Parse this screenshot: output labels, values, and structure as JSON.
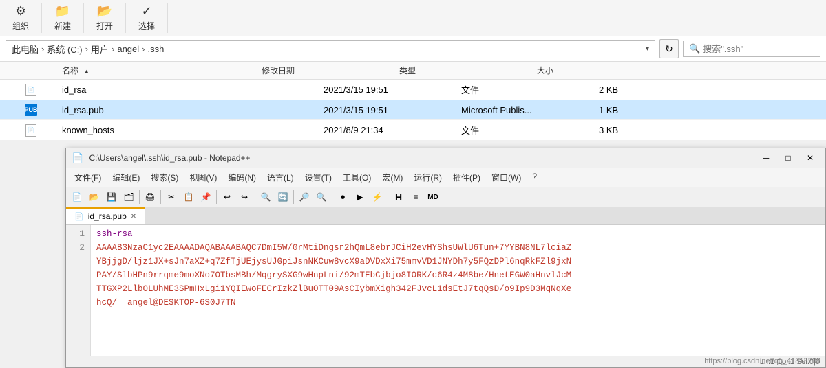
{
  "toolbar": {
    "organize_label": "组织",
    "new_label": "新建",
    "open_label": "打开",
    "select_label": "选择"
  },
  "address": {
    "path_parts": [
      "此电脑",
      "系统 (C:)",
      "用户",
      "angel",
      ".ssh"
    ],
    "search_placeholder": "搜索\".ssh\""
  },
  "file_list": {
    "headers": {
      "name": "名称",
      "date": "修改日期",
      "type": "类型",
      "size": "大小"
    },
    "files": [
      {
        "name": "id_rsa",
        "date": "2021/3/15 19:51",
        "type": "文件",
        "size": "2 KB",
        "icon": "generic",
        "selected": false
      },
      {
        "name": "id_rsa.pub",
        "date": "2021/3/15 19:51",
        "type": "Microsoft Publis...",
        "size": "1 KB",
        "icon": "pub",
        "selected": true
      },
      {
        "name": "known_hosts",
        "date": "2021/8/9 21:34",
        "type": "文件",
        "size": "3 KB",
        "icon": "generic",
        "selected": false
      }
    ]
  },
  "notepad": {
    "title": "C:\\Users\\angel\\.ssh\\id_rsa.pub - Notepad++",
    "icon": "📄",
    "tab_name": "id_rsa.pub",
    "menubar": [
      "文件(F)",
      "编辑(E)",
      "搜索(S)",
      "视图(V)",
      "编码(N)",
      "语言(L)",
      "设置(T)",
      "工具(O)",
      "宏(M)",
      "运行(R)",
      "插件(P)",
      "窗口(W)",
      "?"
    ],
    "code_lines": [
      {
        "num": 1,
        "text": "ssh-rsa",
        "class": "ssh-rsa"
      },
      {
        "num": "",
        "text": "AAAAB3NzaC1yc2EAAAADAQABAAABAQC7DmI5W/0rMtiDngsr2hQmL8ebrJCiH2evHYShsUWlU6Tun+7YYBN8NL7lciaZ",
        "class": "content"
      },
      {
        "num": "",
        "text": "YBjjgD/ljz1JX+sJn7aXZ+q7ZfTjUEjysUJGpiJsnNKCuw8vcX9aDVDxXi75mmvVD1JNYDh7y5FQzDPl6nqRkFZl9jxN",
        "class": "content"
      },
      {
        "num": "",
        "text": "PAY/SlbHPn9rrqme9moXNo7OTbsMBh/MqgrySXG9wHnpLni/92mTEbCjbjo8IORK/c6R4z4M8be/HnetEGW0aHnvlJcM",
        "class": "content"
      },
      {
        "num": "",
        "text": "TTGXP2LlbOLUhME3SPmHxLgi1YQIEwoFECrIzkZlBuOTT09AsCIybmXigh342FJvcL1dsEtJ7tqQsD/o9Ip9D3MqNqXe",
        "class": "content"
      },
      {
        "num": "",
        "text": "hcQ/  angel@DESKTOP-6S0J7TN",
        "class": "content"
      },
      {
        "num": 2,
        "text": "",
        "class": ""
      }
    ]
  },
  "watermark": {
    "text": "https://blog.csdn.net/qq_41813208"
  }
}
